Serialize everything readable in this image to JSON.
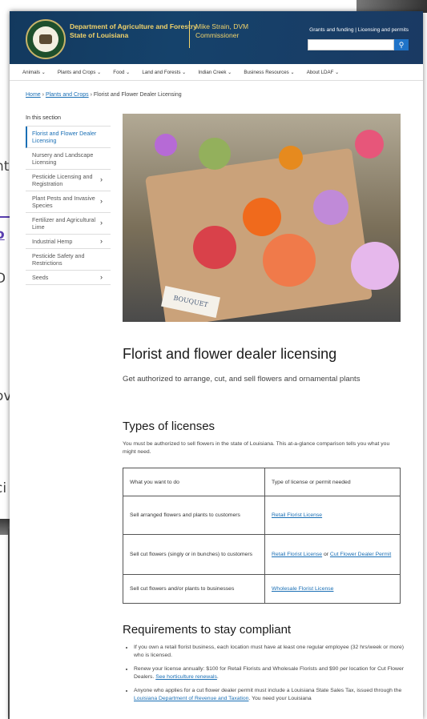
{
  "background_fragments": [
    "nt",
    "o",
    "D",
    "ov",
    "ci"
  ],
  "header": {
    "dept_line1": "Department of Agriculture and Forestry",
    "dept_line2": "State of Louisiana",
    "commissioner_line1": "Mike Strain, DVM",
    "commissioner_line2": "Commissioner",
    "link_grants": "Grants and funding",
    "link_separator": "|",
    "link_licensing": "Licensing and permits",
    "search_placeholder": "",
    "search_icon": "search-icon"
  },
  "nav": [
    "Animals ⌄",
    "Plants and Crops ⌄",
    "Food ⌄",
    "Land and Forests ⌄",
    "Indian Creek ⌄",
    "Business Resources ⌄",
    "About LDAF ⌄"
  ],
  "breadcrumb": {
    "home": "Home",
    "sep1": "›",
    "parent": "Plants and Crops",
    "sep2": "›",
    "current": "Florist and Flower Dealer Licensing"
  },
  "sidebar": {
    "heading": "In this section",
    "items": [
      {
        "label": "Florist and Flower Dealer Licensing",
        "chevron": ""
      },
      {
        "label": "Nursery and Landscape Licensing",
        "chevron": ""
      },
      {
        "label": "Pesticide Licensing and Registration",
        "chevron": "›"
      },
      {
        "label": "Plant Pests and Invasive Species",
        "chevron": "›"
      },
      {
        "label": "Fertilizer and Agricultural Lime",
        "chevron": "›"
      },
      {
        "label": "Industrial Hemp",
        "chevron": "›"
      },
      {
        "label": "Pesticide Safety and Restrictions",
        "chevron": ""
      },
      {
        "label": "Seeds",
        "chevron": "›"
      }
    ]
  },
  "hero": {
    "tag_text": "BOUQUET"
  },
  "main": {
    "title": "Florist and flower dealer licensing",
    "lead": "Get authorized to arrange, cut, and sell flowers and ornamental plants",
    "types_heading": "Types of licenses",
    "types_intro": "You must be authorized to sell flowers in the state of Louisiana. This at-a-glance comparison tells you what you might need.",
    "table": {
      "col1": "What you want to do",
      "col2": "Type of license or permit needed",
      "rows": [
        {
          "want": "Sell arranged flowers and plants to customers",
          "l1": "Retail Florist License",
          "mid": "",
          "l2": ""
        },
        {
          "want": "Sell cut flowers (singly or in bunches) to customers",
          "l1": "Retail Florist License",
          "mid": " or ",
          "l2": "Cut Flower Dealer Permit"
        },
        {
          "want": "Sell cut flowers and/or plants to businesses",
          "l1": "Wholesale Florist License",
          "mid": "",
          "l2": ""
        }
      ]
    },
    "req_heading": "Requirements to stay compliant",
    "req": {
      "b1": "If you own a retail florist business, each location must have at least one regular employee (32 hrs/week or more) who is licensed.",
      "b2_text": "Renew your license annually: $100 for Retail Florists and Wholesale Florists and $90 per location for Cut Flower Dealers. ",
      "b2_link": "See horticulture renewals",
      "b2_end": ".",
      "b3_text": "Anyone who applies for a cut flower dealer permit must include a Louisiana State Sales Tax, issued through the ",
      "b3_link": "Louisiana Department of Revenue and Taxation",
      "b3_end": ". You need your Louisiana"
    }
  }
}
